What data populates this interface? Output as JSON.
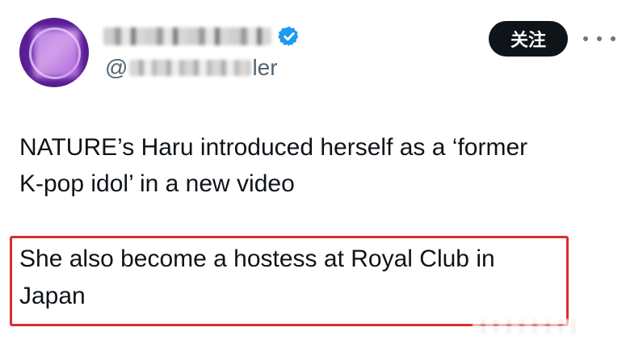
{
  "header": {
    "handle_prefix": "@",
    "handle_suffix": "ler",
    "follow_label": "关注",
    "verified_color": "#1d9bf0",
    "follow_bg": "#0f1419"
  },
  "tweet": {
    "text_line1": "NATURE’s Haru introduced herself as a ‘former",
    "text_line2": "K-pop idol’ in a new video",
    "highlight_line1": "She also become a hostess at Royal Club in",
    "highlight_line2": "Japan",
    "highlight_color": "#d6302b"
  },
  "icons": {
    "verified": "verified-badge-icon",
    "more": "more-options-icon"
  }
}
